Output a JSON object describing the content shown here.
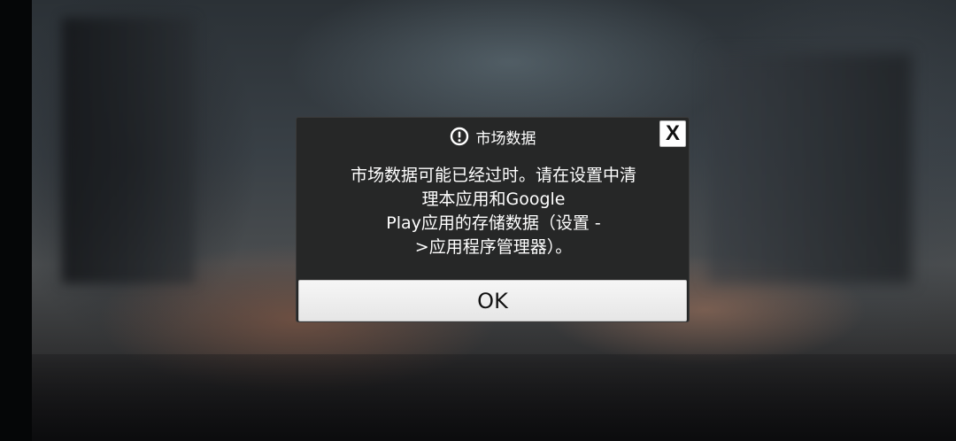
{
  "dialog": {
    "title": "市场数据",
    "title_icon": "exclamation-circle-icon",
    "close_label": "X",
    "message": "市场数据可能已经过时。请在设置中清\n理本应用和Google\nPlay应用的存储数据（设置 -\n>应用程序管理器）。",
    "ok_label": "OK"
  },
  "colors": {
    "dialog_bg": "#262727",
    "button_bg": "#f0f0f0",
    "text_light": "#ffffff",
    "text_dark": "#111111"
  }
}
